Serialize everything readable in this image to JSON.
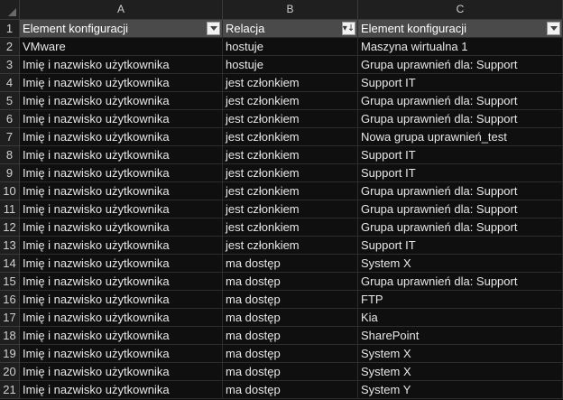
{
  "columns": [
    "A",
    "B",
    "C"
  ],
  "header": {
    "col_a": "Element konfiguracji",
    "col_b": "Relacja",
    "col_c": "Element konfiguracji",
    "row_number": "1"
  },
  "rows": [
    {
      "n": "2",
      "a": "VMware",
      "b": "hostuje",
      "c": "Maszyna wirtualna 1"
    },
    {
      "n": "3",
      "a": "Imię i nazwisko użytkownika",
      "b": "hostuje",
      "c": "Grupa uprawnień dla: Support"
    },
    {
      "n": "4",
      "a": "Imię i nazwisko użytkownika",
      "b": "jest członkiem",
      "c": "Support IT"
    },
    {
      "n": "5",
      "a": "Imię i nazwisko użytkownika",
      "b": "jest członkiem",
      "c": "Grupa uprawnień dla: Support"
    },
    {
      "n": "6",
      "a": "Imię i nazwisko użytkownika",
      "b": "jest członkiem",
      "c": "Grupa uprawnień dla: Support"
    },
    {
      "n": "7",
      "a": "Imię i nazwisko użytkownika",
      "b": "jest członkiem",
      "c": "Nowa grupa uprawnień_test"
    },
    {
      "n": "8",
      "a": "Imię i nazwisko użytkownika",
      "b": "jest członkiem",
      "c": "Support IT"
    },
    {
      "n": "9",
      "a": "Imię i nazwisko użytkownika",
      "b": "jest członkiem",
      "c": "Support IT"
    },
    {
      "n": "10",
      "a": "Imię i nazwisko użytkownika",
      "b": "jest członkiem",
      "c": "Grupa uprawnień dla: Support"
    },
    {
      "n": "11",
      "a": "Imię i nazwisko użytkownika",
      "b": "jest członkiem",
      "c": "Grupa uprawnień dla: Support"
    },
    {
      "n": "12",
      "a": "Imię i nazwisko użytkownika",
      "b": "jest członkiem",
      "c": "Grupa uprawnień dla: Support"
    },
    {
      "n": "13",
      "a": "Imię i nazwisko użytkownika",
      "b": "jest członkiem",
      "c": "Support IT"
    },
    {
      "n": "14",
      "a": "Imię i nazwisko użytkownika",
      "b": "ma dostęp",
      "c": "System X"
    },
    {
      "n": "15",
      "a": "Imię i nazwisko użytkownika",
      "b": "ma dostęp",
      "c": "Grupa uprawnień dla: Support"
    },
    {
      "n": "16",
      "a": "Imię i nazwisko użytkownika",
      "b": "ma dostęp",
      "c": "FTP"
    },
    {
      "n": "17",
      "a": "Imię i nazwisko użytkownika",
      "b": "ma dostęp",
      "c": "Kia"
    },
    {
      "n": "18",
      "a": "Imię i nazwisko użytkownika",
      "b": "ma dostęp",
      "c": "SharePoint"
    },
    {
      "n": "19",
      "a": "Imię i nazwisko użytkownika",
      "b": "ma dostęp",
      "c": "System X"
    },
    {
      "n": "20",
      "a": "Imię i nazwisko użytkownika",
      "b": "ma dostęp",
      "c": "System X"
    },
    {
      "n": "21",
      "a": "Imię i nazwisko użytkownika",
      "b": "ma dostęp",
      "c": "System Y"
    }
  ],
  "icons": {
    "filter_a": "filter-dropdown-icon",
    "filter_b": "sort-filter-icon",
    "filter_c": "filter-dropdown-icon"
  }
}
